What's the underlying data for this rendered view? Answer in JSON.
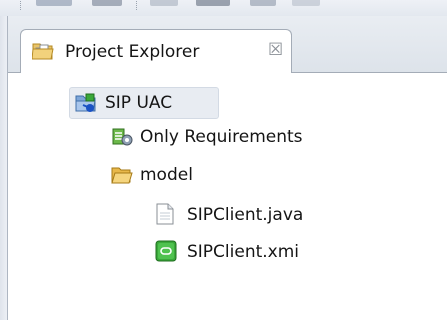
{
  "view": {
    "title": "Project Explorer",
    "close_glyph": "☒"
  },
  "tree": {
    "project": {
      "label": "SIP UAC",
      "icon": "project-folder-icon",
      "selected": true
    },
    "children": [
      {
        "label": "Only Requirements",
        "icon": "requirements-filter-icon"
      },
      {
        "label": "model",
        "icon": "open-folder-icon",
        "children": [
          {
            "label": "SIPClient.java",
            "icon": "file-icon"
          },
          {
            "label": "SIPClient.xmi",
            "icon": "model-file-icon"
          }
        ]
      }
    ]
  },
  "colors": {
    "folder": "#e8b84a",
    "selection": "#e8ecf2",
    "model_icon": "#3aa83a"
  }
}
